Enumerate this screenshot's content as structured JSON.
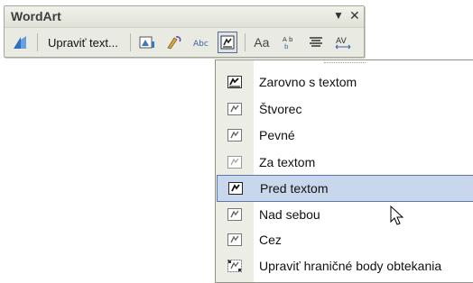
{
  "toolbar": {
    "title": "WordArt",
    "edit_text_label": "Upraviť text...",
    "font_sample_label": "Aa",
    "buttons": [
      {
        "icon": "insert-wordart-icon"
      },
      {
        "icon": "edit-text"
      },
      {
        "icon": "wordart-gallery-icon"
      },
      {
        "icon": "format-wordart-icon"
      },
      {
        "icon": "wordart-shape-icon"
      },
      {
        "icon": "text-wrapping-icon",
        "pressed": true
      },
      {
        "icon": "same-letter-heights-icon"
      },
      {
        "icon": "vertical-text-icon"
      },
      {
        "icon": "alignment-icon"
      },
      {
        "icon": "character-spacing-icon"
      }
    ]
  },
  "menu": {
    "items": [
      {
        "label": "Zarovno s textom",
        "icon": "in-line-with-text-icon"
      },
      {
        "label": "Štvorec",
        "icon": "square-wrap-icon"
      },
      {
        "label": "Pevné",
        "icon": "tight-wrap-icon"
      },
      {
        "label": "Za textom",
        "icon": "behind-text-icon"
      },
      {
        "label": "Pred textom",
        "icon": "in-front-of-text-icon",
        "highlighted": true
      },
      {
        "label": "Nad sebou",
        "icon": "top-bottom-wrap-icon"
      },
      {
        "label": "Cez",
        "icon": "through-wrap-icon"
      },
      {
        "label": "Upraviť hraničné body obtekania",
        "icon": "edit-wrap-points-icon"
      }
    ]
  },
  "colors": {
    "toolbar_bg": "#e9ebe2",
    "menu_highlight": "#c9d7ec",
    "menu_highlight_border": "#5b77a9"
  }
}
